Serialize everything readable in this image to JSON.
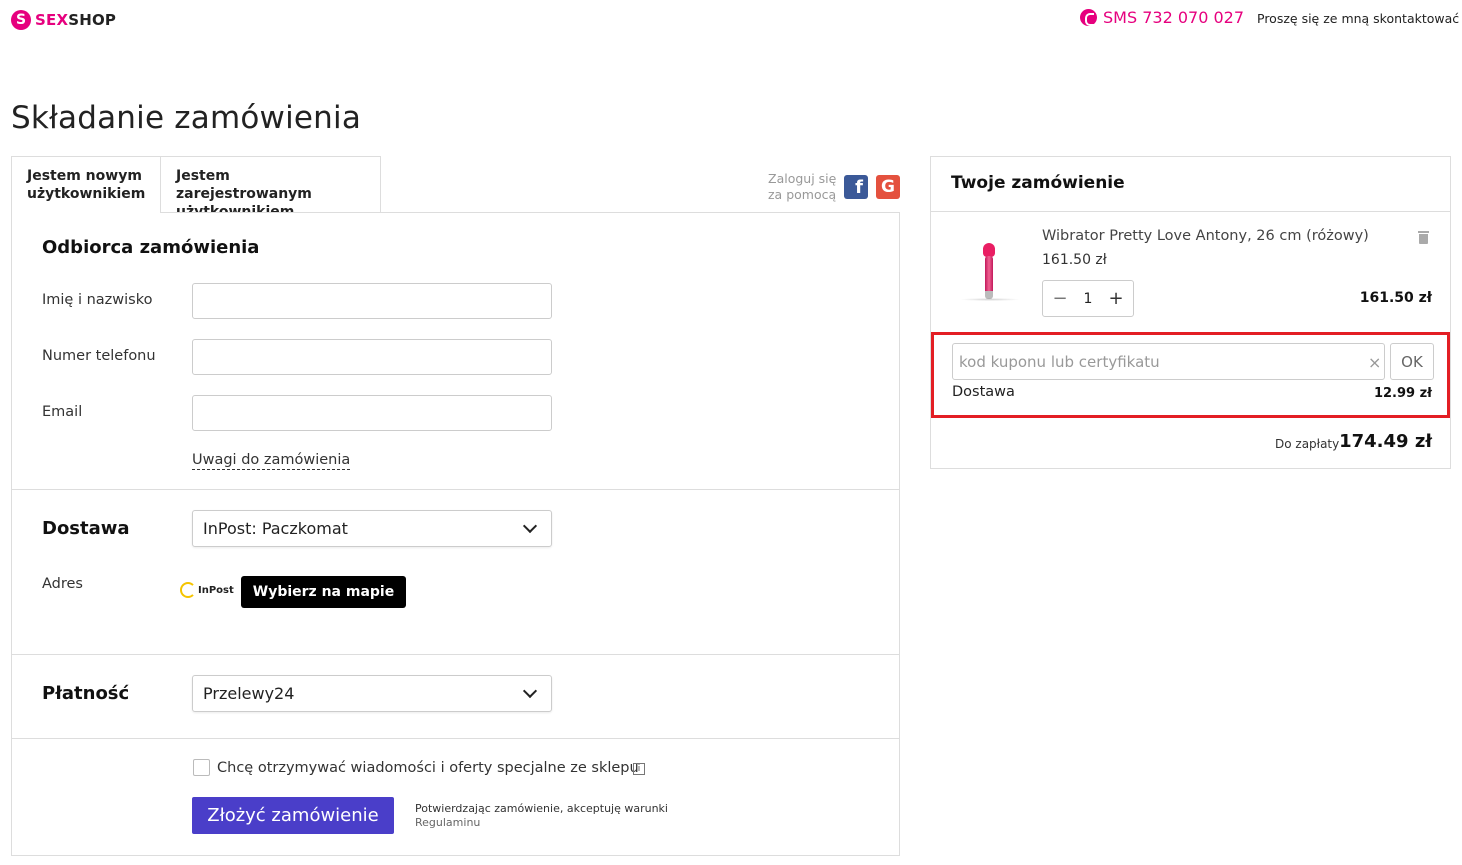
{
  "header": {
    "logo_mark": "S",
    "logo_part1": "SEX",
    "logo_part2": "SHOP",
    "sms": "SMS 732 070 027",
    "contact_link": "Proszę się ze mną skontaktować",
    "brand_color": "#e6007e"
  },
  "page_title": "Składanie zamówienia",
  "tabs": [
    {
      "label_line1": "Jestem nowym",
      "label_line2": "użytkownikiem",
      "active": true
    },
    {
      "label_line1": "Jestem zarejestrowanym",
      "label_line2": "użytkownikiem",
      "active": false
    }
  ],
  "social": {
    "text_line1": "Zaloguj się",
    "text_line2": "za pomocą",
    "facebook_glyph": "f",
    "google_glyph": "G"
  },
  "recipient": {
    "title": "Odbiorca zamówienia",
    "fields": [
      {
        "label": "Imię i nazwisko",
        "value": ""
      },
      {
        "label": "Numer telefonu",
        "value": ""
      },
      {
        "label": "Email",
        "value": ""
      }
    ],
    "notes_link": "Uwagi do zamówienia"
  },
  "delivery": {
    "title": "Dostawa",
    "selected": "InPost: Paczkomat",
    "address_label": "Adres",
    "carrier_logo_text": "InPost",
    "map_button": "Wybierz na mapie"
  },
  "payment": {
    "title": "Płatność",
    "selected": "Przelewy24"
  },
  "newsletter": {
    "label": "Chcę otrzymywać wiadomości i oferty specjalne ze sklepu",
    "checked": false,
    "info_glyph": "i"
  },
  "submit": {
    "label": "Złożyć zamówienie",
    "terms_line1": "Potwierdzając zamówienie, akceptuję warunki",
    "terms_link": "Regulaminu",
    "color": "#4a3ec9"
  },
  "order": {
    "title": "Twoje zamówienie",
    "item": {
      "name": "Wibrator Pretty Love Antony, 26 cm (różowy)",
      "unit_price": "161.50 zł",
      "quantity": "1",
      "minus": "−",
      "plus": "+",
      "line_total": "161.50 zł"
    },
    "coupon": {
      "placeholder": "kod kuponu lub certyfikatu",
      "value": "",
      "clear_glyph": "×",
      "ok_label": "OK"
    },
    "delivery_label": "Dostawa",
    "delivery_price": "12.99 zł",
    "total_label": "Do zapłaty",
    "total_value": "174.49 zł",
    "highlight_color": "#e31e24"
  }
}
